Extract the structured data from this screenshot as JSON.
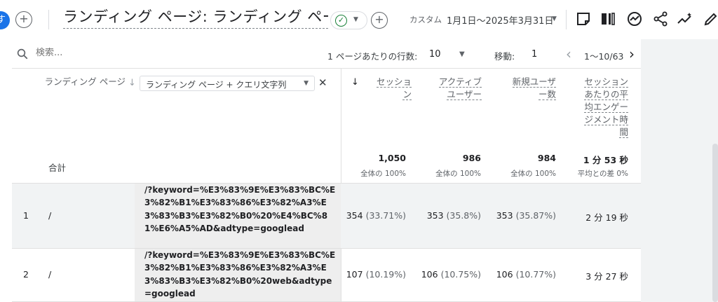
{
  "header": {
    "avatar_letter": "す",
    "title": "ランディング ページ: ランディング ページ",
    "date_label": "カスタム",
    "date_range": "1月1日～2025年3月31日"
  },
  "toolbar": {
    "search_placeholder": "検索...",
    "rows_per_page_label": "1 ページあたりの行数:",
    "rows_per_page_value": "10",
    "goto_label": "移動:",
    "goto_value": "1",
    "pagination": "1～10/63"
  },
  "table": {
    "dimension_label": "ランディング ページ",
    "secondary_dimension": "ランディング ページ + クエリ文字列",
    "columns": [
      {
        "label": "セッション",
        "total": "1,050",
        "total_sub": "全体の 100%"
      },
      {
        "label": "アクティブ ユーザー",
        "total": "986",
        "total_sub": "全体の 100%"
      },
      {
        "label": "新規ユーザー数",
        "total": "984",
        "total_sub": "全体の 100%"
      },
      {
        "label": "セッションあたりの平均エンゲージメント時間",
        "total": "1 分 53 秒",
        "total_sub": "平均との差 0%"
      }
    ],
    "total_label": "合計",
    "rows": [
      {
        "num": "1",
        "dim1": "/",
        "dim2": "/?keyword=%E3%83%9E%E3%83%BC%E3%82%B1%E3%83%86%E3%82%A3%E3%83%B3%E3%82%B0%20%E4%BC%81%E6%A5%AD&adtype=googlead",
        "sessions": "354",
        "sessions_pct": "(33.71%)",
        "active": "353",
        "active_pct": "(35.8%)",
        "new": "353",
        "new_pct": "(35.87%)",
        "time": "2 分 19 秒"
      },
      {
        "num": "2",
        "dim1": "/",
        "dim2": "/?keyword=%E3%83%9E%E3%83%BC%E3%82%B1%E3%83%86%E3%82%A3%E3%83%B3%E3%82%B0%20web&adtype=googlead",
        "sessions": "107",
        "sessions_pct": "(10.19%)",
        "active": "106",
        "active_pct": "(10.75%)",
        "new": "106",
        "new_pct": "(10.77%)",
        "time": "3 分 27 秒"
      }
    ]
  }
}
